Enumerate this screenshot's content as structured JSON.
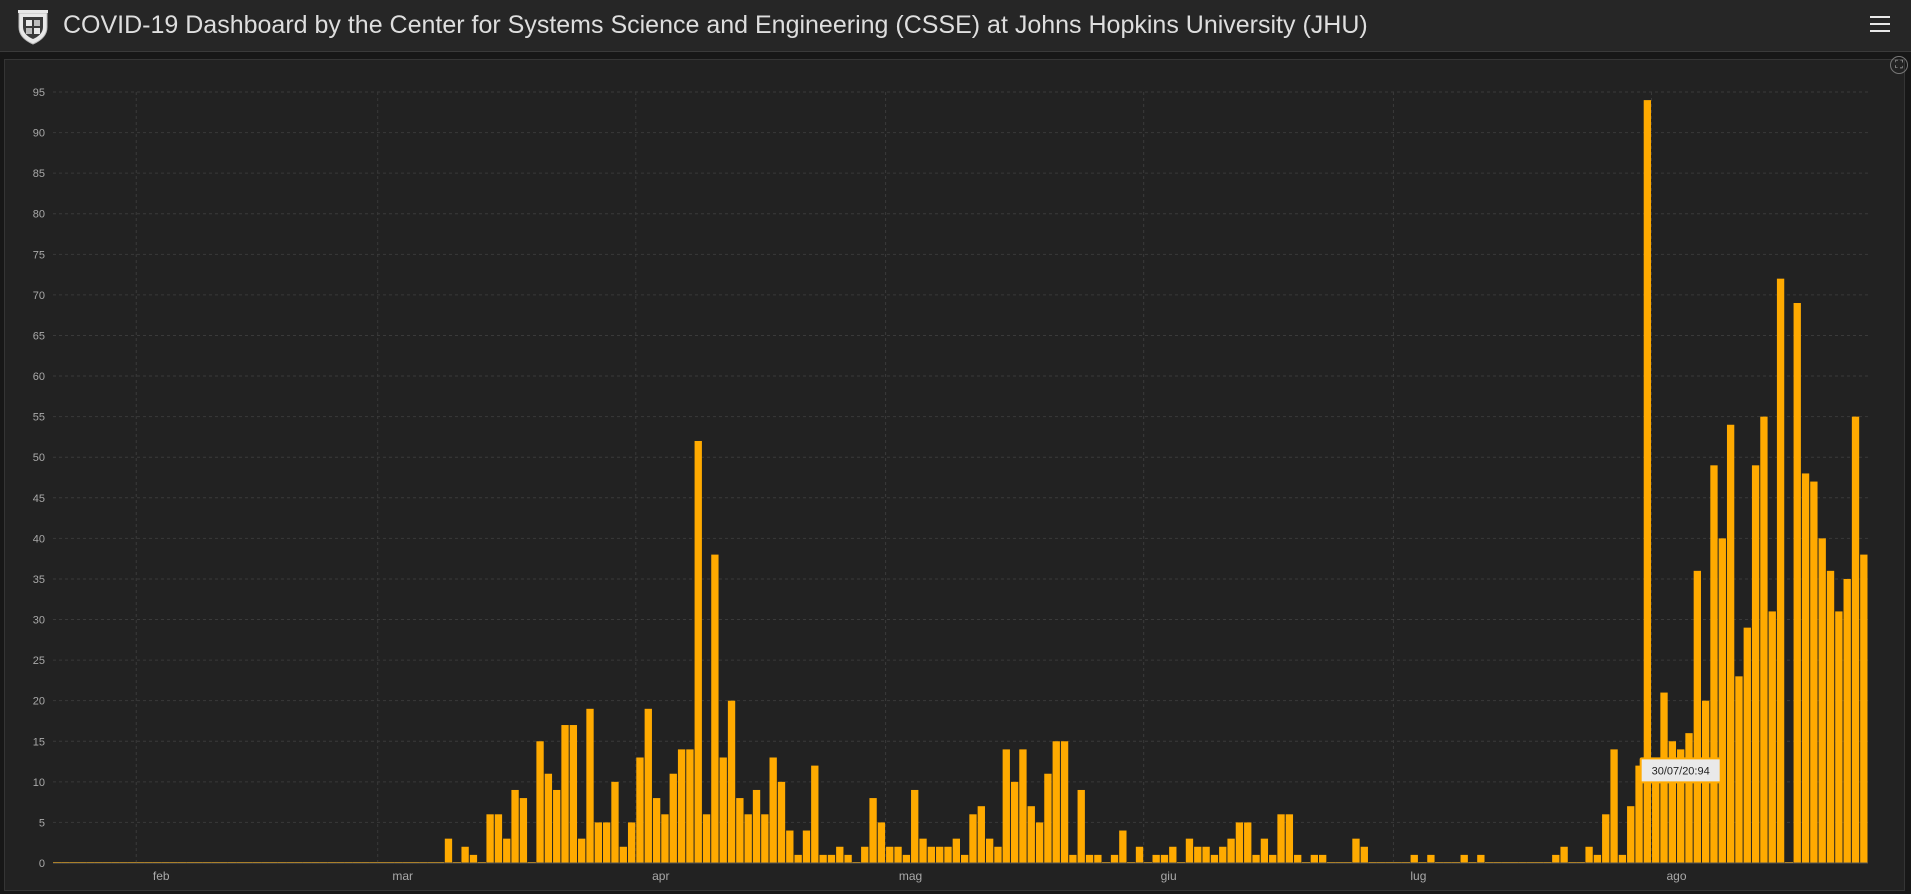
{
  "header": {
    "title": "COVID-19 Dashboard by the Center for Systems Science and Engineering (CSSE) at Johns Hopkins University (JHU)",
    "logo_icon": "university-shield-icon",
    "menu_icon": "hamburger-menu-icon"
  },
  "panel": {
    "expand_icon": "expand-icon"
  },
  "colors": {
    "background": "#171717",
    "header_bg": "#262626",
    "panel_bg": "#222222",
    "bar": "#ffaa00",
    "grid": "#3a3a3a",
    "tick_text": "#a9a9a9"
  },
  "chart_data": {
    "type": "bar",
    "title": "",
    "xlabel": "",
    "ylabel": "",
    "ylim": [
      0,
      95
    ],
    "y_ticks": [
      0,
      5,
      10,
      15,
      20,
      25,
      30,
      35,
      40,
      45,
      50,
      55,
      60,
      65,
      70,
      75,
      80,
      85,
      90,
      95
    ],
    "x_tick_labels": [
      "feb",
      "mar",
      "apr",
      "mag",
      "giu",
      "lug",
      "ago"
    ],
    "grid": true,
    "bar_color": "#ffaa00",
    "tooltip": {
      "text": "30/07/20:94",
      "day_index": 195
    },
    "days": 222,
    "first_day": "2020-01-22",
    "values": [
      0,
      0,
      0,
      0,
      0,
      0,
      0,
      0,
      0,
      0,
      0,
      0,
      0,
      0,
      0,
      0,
      0,
      0,
      0,
      0,
      0,
      0,
      0,
      0,
      0,
      0,
      0,
      0,
      0,
      0,
      0,
      0,
      0,
      0,
      0,
      0,
      0,
      0,
      0,
      0,
      0,
      0,
      0,
      0,
      0,
      0,
      0,
      3,
      0,
      2,
      1,
      0,
      6,
      6,
      3,
      9,
      8,
      0,
      15,
      11,
      9,
      17,
      17,
      3,
      19,
      5,
      5,
      10,
      2,
      5,
      13,
      19,
      8,
      6,
      11,
      14,
      14,
      52,
      6,
      38,
      13,
      20,
      8,
      6,
      9,
      6,
      13,
      10,
      4,
      1,
      4,
      12,
      1,
      1,
      2,
      1,
      0,
      2,
      8,
      5,
      2,
      2,
      1,
      9,
      3,
      2,
      2,
      2,
      3,
      1,
      6,
      7,
      3,
      2,
      14,
      10,
      14,
      7,
      5,
      11,
      15,
      15,
      1,
      9,
      1,
      1,
      0,
      1,
      4,
      0,
      2,
      0,
      1,
      1,
      2,
      0,
      3,
      2,
      2,
      1,
      2,
      3,
      5,
      5,
      1,
      3,
      1,
      6,
      6,
      1,
      0,
      1,
      1,
      0,
      0,
      0,
      3,
      2,
      0,
      0,
      0,
      0,
      0,
      1,
      0,
      1,
      0,
      0,
      0,
      1,
      0,
      1,
      0,
      0,
      0,
      0,
      0,
      0,
      0,
      0,
      1,
      2,
      0,
      0,
      2,
      1,
      6,
      14,
      1,
      7,
      12,
      94,
      10,
      21,
      15,
      14,
      16,
      36,
      20,
      49,
      40,
      54,
      23,
      29,
      49,
      55,
      31,
      72,
      0,
      69,
      48,
      47,
      40,
      36,
      31,
      35,
      55,
      38
    ]
  }
}
